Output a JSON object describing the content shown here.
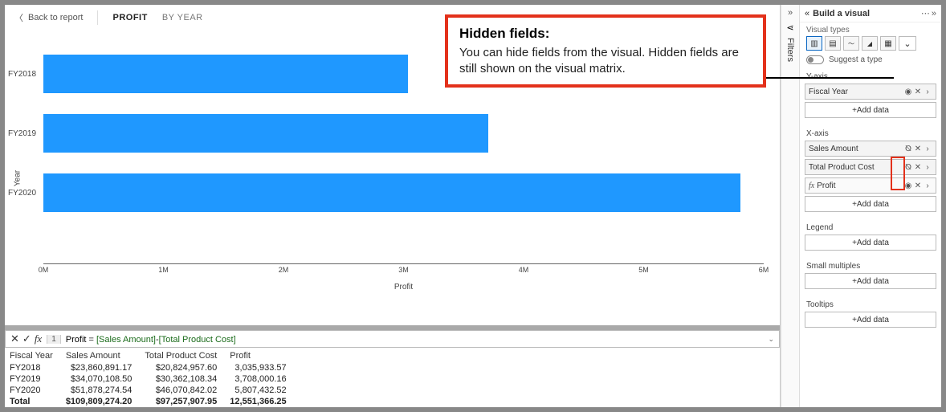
{
  "nav": {
    "back_label": "Back to report",
    "crumb_active": "PROFIT",
    "crumb_secondary": "BY YEAR"
  },
  "chart_data": {
    "type": "bar",
    "orientation": "horizontal",
    "title": "",
    "ylabel": "Year",
    "xlabel": "Profit",
    "categories": [
      "FY2018",
      "FY2019",
      "FY2020"
    ],
    "values": [
      3035934,
      3708000,
      5807433
    ],
    "xlim": [
      0,
      6000000
    ],
    "xticks": [
      "0M",
      "1M",
      "2M",
      "3M",
      "4M",
      "5M",
      "6M"
    ],
    "bar_color": "#1f98ff"
  },
  "formula": {
    "line_no": "1",
    "measure": "Profit",
    "eq": " = ",
    "col1": "[Sales Amount]",
    "op": "-",
    "col2": "[Total Product Cost]"
  },
  "matrix": {
    "headers": [
      "Fiscal Year",
      "Sales Amount",
      "Total Product Cost",
      "Profit"
    ],
    "rows": [
      [
        "FY2018",
        "$23,860,891.17",
        "$20,824,957.60",
        "3,035,933.57"
      ],
      [
        "FY2019",
        "$34,070,108.50",
        "$30,362,108.34",
        "3,708,000.16"
      ],
      [
        "FY2020",
        "$51,878,274.54",
        "$46,070,842.02",
        "5,807,432.52"
      ]
    ],
    "total": [
      "Total",
      "$109,809,274.20",
      "$97,257,907.95",
      "12,551,366.25"
    ]
  },
  "filters": {
    "label": "Filters"
  },
  "build": {
    "title": "Build a visual",
    "visual_types_label": "Visual types",
    "suggest_label": "Suggest a type",
    "add_label": "+Add data",
    "wells": {
      "yaxis": {
        "label": "Y-axis",
        "items": [
          {
            "name": "Fiscal Year",
            "hidden": false,
            "measure": false
          }
        ]
      },
      "xaxis": {
        "label": "X-axis",
        "items": [
          {
            "name": "Sales Amount",
            "hidden": true,
            "measure": false
          },
          {
            "name": "Total Product Cost",
            "hidden": true,
            "measure": false
          },
          {
            "name": "Profit",
            "hidden": false,
            "measure": true
          }
        ]
      },
      "legend": {
        "label": "Legend"
      },
      "small_multiples": {
        "label": "Small multiples"
      },
      "tooltips": {
        "label": "Tooltips"
      }
    }
  },
  "callout": {
    "heading": "Hidden fields:",
    "body": "You can hide fields from the visual. Hidden fields are still shown on the visual matrix."
  }
}
